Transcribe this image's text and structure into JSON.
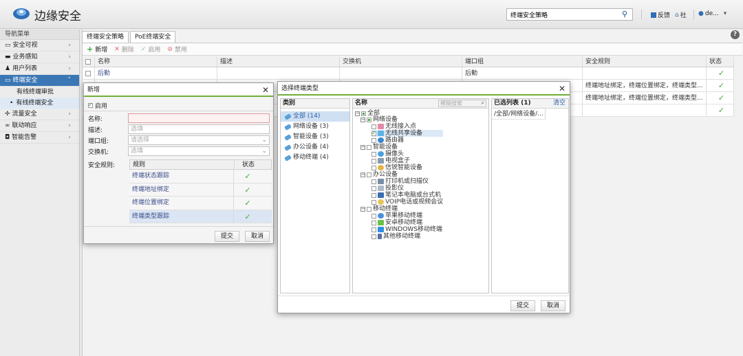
{
  "app": {
    "title": "边缘安全"
  },
  "header": {
    "search_value": "终端安全策略",
    "feedback": "反馈",
    "community": "社",
    "user": "de...",
    "user_caret": "▾"
  },
  "sidebar": {
    "header": "导航菜单",
    "items": [
      {
        "label": "安全可视",
        "arrow": "›"
      },
      {
        "label": "业务感知",
        "arrow": "›"
      },
      {
        "label": "用户列表",
        "arrow": "›"
      },
      {
        "label": "终端安全",
        "arrow": "˅"
      },
      {
        "label": "流量安全",
        "arrow": "›"
      },
      {
        "label": "联动响应",
        "arrow": "›"
      },
      {
        "label": "智能告警",
        "arrow": "›"
      }
    ],
    "subitems": [
      {
        "label": "有线终端审批"
      },
      {
        "label": "有线终端安全",
        "bullet": "•"
      }
    ]
  },
  "tabs": [
    {
      "label": "终端安全策略"
    },
    {
      "label": "PoE终端安全"
    }
  ],
  "toolbar": {
    "add": "新增",
    "delete": "删除",
    "enable": "启用",
    "disable": "禁用"
  },
  "grid": {
    "columns": [
      "名称",
      "描述",
      "交换机",
      "端口组",
      "安全规则",
      "状态"
    ],
    "rows": [
      {
        "name": "后勤",
        "desc": "",
        "switch": "",
        "port": "后勤",
        "rules": "",
        "status": "✓"
      },
      {
        "name": "",
        "desc": "",
        "switch": "",
        "port": "",
        "rules": "终端地址绑定，终端位置绑定，终端类型...",
        "status": "✓"
      },
      {
        "name": "",
        "desc": "",
        "switch": "",
        "port": "",
        "rules": "终端地址绑定，终端位置绑定，终端类型...",
        "status": "✓"
      },
      {
        "name": "",
        "desc": "",
        "switch": "...",
        "port": "",
        "rules": "",
        "status": "✓"
      }
    ]
  },
  "dialog_new": {
    "title": "新增",
    "enable_label": "启用",
    "name_label": "名称:",
    "desc_label": "描述:",
    "desc_placeholder": "选填",
    "port_label": "端口组:",
    "port_placeholder": "请选择",
    "switch_label": "交换机:",
    "switch_placeholder": "选填",
    "rules_label": "安全规则:",
    "rules_header": {
      "rule": "规则",
      "status": "状态"
    },
    "rules": [
      {
        "name": "终端状态跟踪",
        "status": "✓"
      },
      {
        "name": "终端地址绑定",
        "status": "✓"
      },
      {
        "name": "终端位置绑定",
        "status": "✓"
      },
      {
        "name": "终端类型跟踪",
        "status": "✓"
      }
    ],
    "submit": "提交",
    "cancel": "取消"
  },
  "dialog_type": {
    "title": "选择终端类型",
    "category_header": "类别",
    "name_header": "名称",
    "search_placeholder": "模糊搜索",
    "selected_header": "已选列表 (1)",
    "clear": "清空",
    "categories": [
      {
        "label": "全部 (14)"
      },
      {
        "label": "网络设备 (3)"
      },
      {
        "label": "智能设备 (3)"
      },
      {
        "label": "办公设备 (4)"
      },
      {
        "label": "移动终端 (4)"
      }
    ],
    "tree": {
      "all": "全部",
      "net": "网络设备",
      "net_items": [
        "无线接入点",
        "无线共享设备",
        "路由器"
      ],
      "smart": "智能设备",
      "smart_items": [
        "摄像头",
        "电视盒子",
        "信锐智能设备"
      ],
      "office": "办公设备",
      "office_items": [
        "打印机或扫描仪",
        "投影仪",
        "笔记本电脑或台式机",
        "VOIP电话或视频会议"
      ],
      "mobile": "移动终端",
      "mobile_items": [
        "苹果移动终端",
        "安卓移动终端",
        "WINDOWS移动终端",
        "其他移动终端"
      ]
    },
    "selected": [
      "/全部/网络设备/..."
    ],
    "submit": "提交",
    "cancel": "取消"
  },
  "colors": {
    "accent_blue": "#3b77b5",
    "green": "#3aa83a",
    "brand_blue": "#2f6fb6"
  }
}
